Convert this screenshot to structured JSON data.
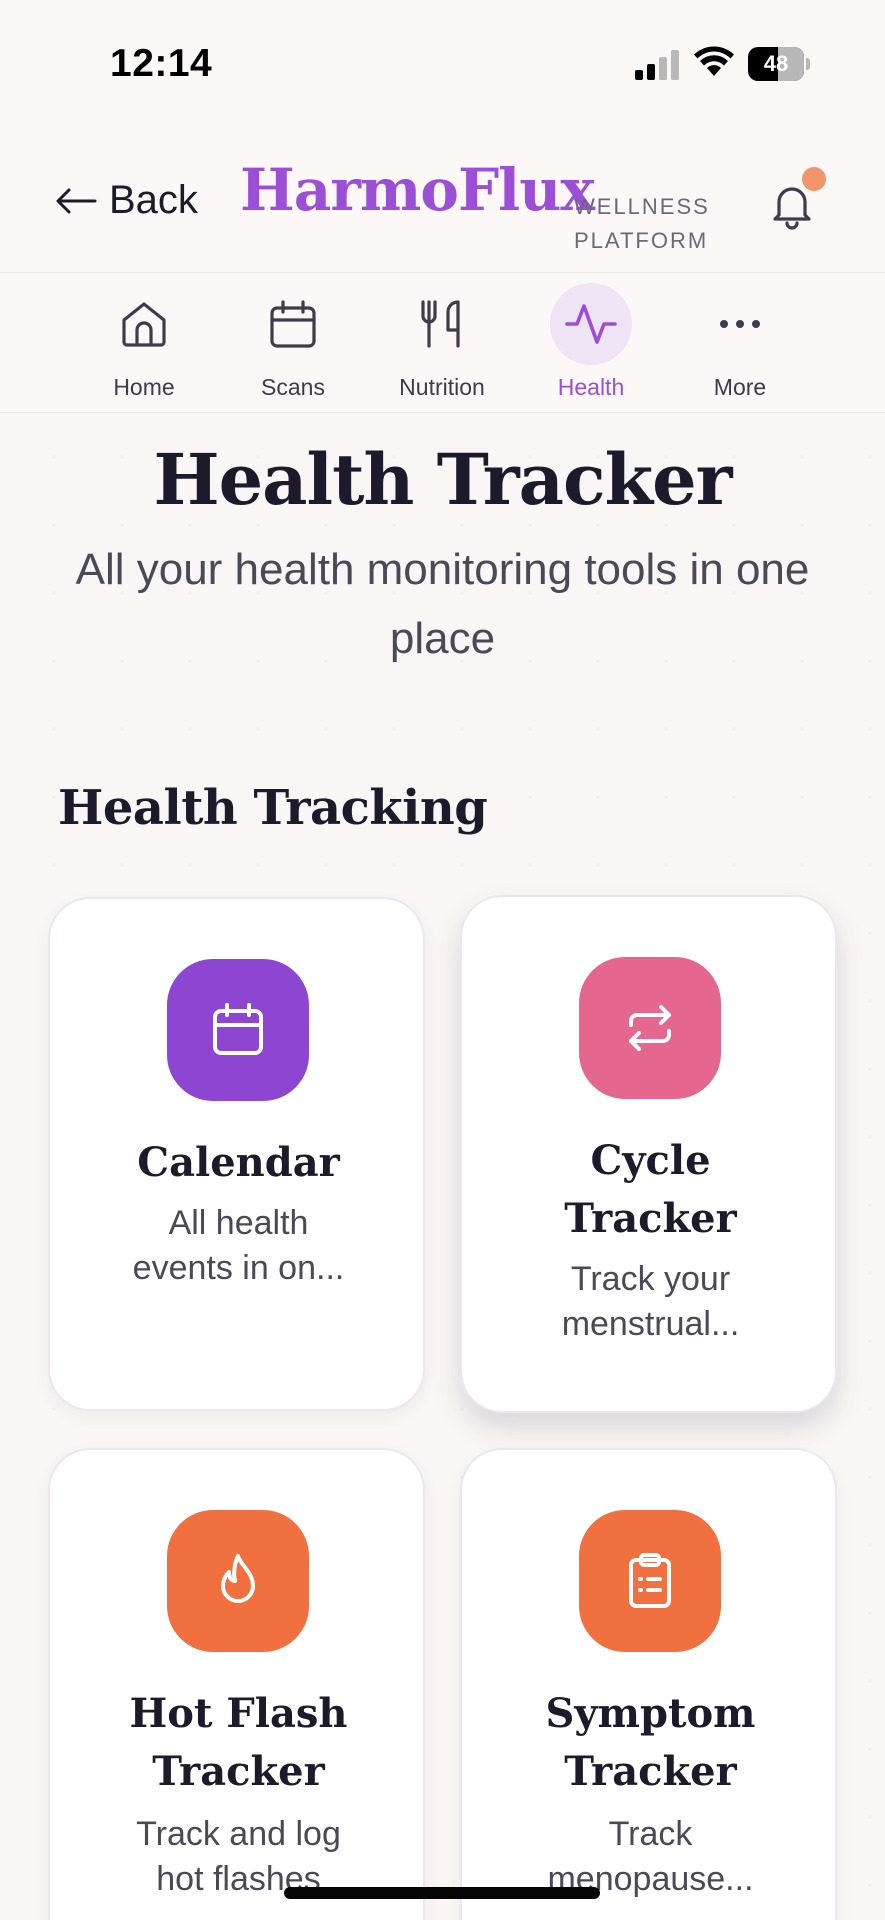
{
  "status_bar": {
    "time": "12:14",
    "battery": "48"
  },
  "header": {
    "back_label": "Back",
    "brand": "HarmoFlux",
    "tagline_line1": "WELLNESS",
    "tagline_line2": "PLATFORM"
  },
  "nav": {
    "items": [
      {
        "label": "Home",
        "icon": "home-icon",
        "active": false
      },
      {
        "label": "Scans",
        "icon": "calendar-icon",
        "active": false
      },
      {
        "label": "Nutrition",
        "icon": "utensils-icon",
        "active": false
      },
      {
        "label": "Health",
        "icon": "activity-icon",
        "active": true
      },
      {
        "label": "More",
        "icon": "more-icon",
        "active": false
      }
    ]
  },
  "page": {
    "title": "Health Tracker",
    "subtitle": "All your health monitoring tools in one place",
    "section_title": "Health Tracking"
  },
  "cards": [
    {
      "title": "Calendar",
      "description_line1": "All health",
      "description_line2": "events in on...",
      "icon": "calendar-icon",
      "color": "#8c46d1"
    },
    {
      "title_line1": "Cycle",
      "title_line2": "Tracker",
      "description_line1": "Track your",
      "description_line2": "menstrual...",
      "icon": "repeat-icon",
      "color": "#e5678f"
    },
    {
      "title_line1": "Hot Flash",
      "title_line2": "Tracker",
      "description_line1": "Track and log",
      "description_line2": "hot flashes",
      "icon": "flame-icon",
      "color": "#f07040"
    },
    {
      "title_line1": "Symptom",
      "title_line2": "Tracker",
      "description_line1": "Track",
      "description_line2": "menopause...",
      "icon": "clipboard-list-icon",
      "color": "#f07040"
    }
  ],
  "colors": {
    "accent": "#9b4fd6",
    "notification": "#f0956c",
    "text_dark": "#1c1a2b",
    "text_muted": "#4b4858"
  }
}
